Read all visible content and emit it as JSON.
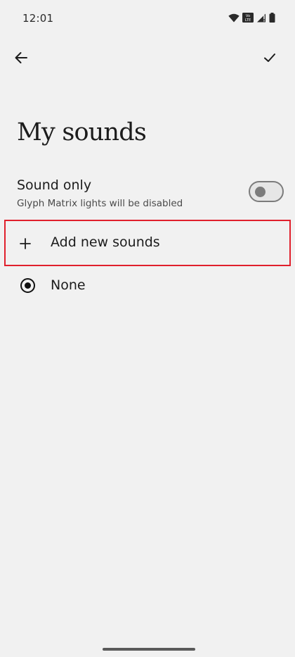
{
  "status_bar": {
    "time": "12:01",
    "icons": [
      "wifi-icon",
      "volte-icon",
      "signal-icon",
      "battery-icon"
    ],
    "volte_text_top": "Vo",
    "volte_text_bottom": "LTE"
  },
  "top_bar": {
    "back_icon": "arrow-left-icon",
    "confirm_icon": "checkmark-icon"
  },
  "page": {
    "title": "My sounds"
  },
  "sound_only": {
    "title": "Sound only",
    "subtitle": "Glyph Matrix lights will be disabled",
    "enabled": false
  },
  "add_sounds": {
    "icon": "plus-icon",
    "label": "Add new sounds",
    "highlight_color": "#e0202c"
  },
  "sounds": [
    {
      "label": "None",
      "selected": true
    }
  ]
}
